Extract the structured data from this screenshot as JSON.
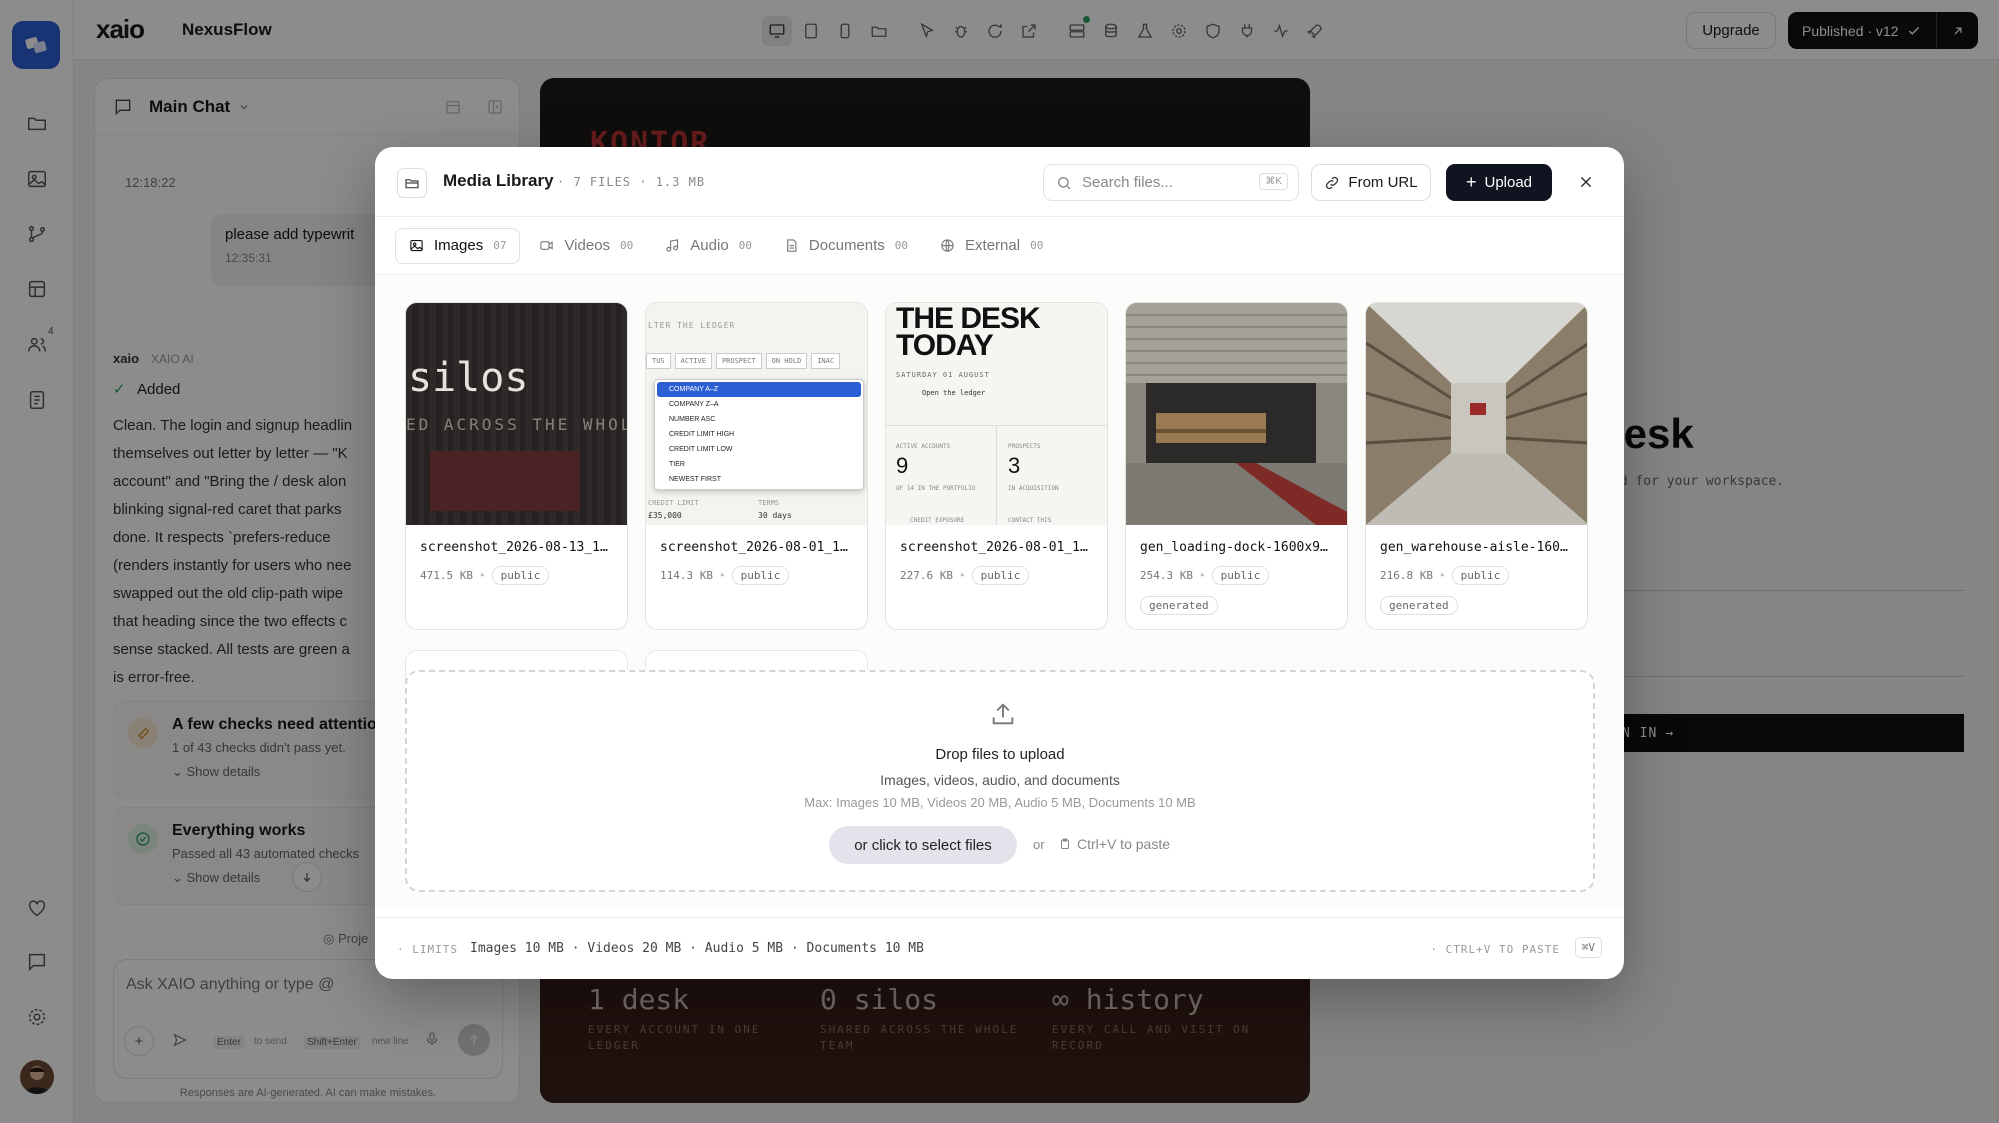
{
  "app": {
    "brand": "xaio",
    "project": "NexusFlow",
    "upgrade_label": "Upgrade",
    "published_label": "Published · v12",
    "rail_badge": "4"
  },
  "chat": {
    "title": "Main Chat",
    "time1": "12:18:22",
    "user_msg": "please add typewrit",
    "user_time": "12:35:31",
    "ai_brand": "xaio",
    "ai_name": "XAIO AI",
    "added": "Added",
    "body_lines": [
      "Clean. The login and signup headlin",
      "themselves out letter by letter — \"K",
      "account\" and \"Bring the / desk alon",
      "blinking signal-red caret that parks",
      "done. It respects `prefers-reduce",
      "(renders instantly for users who nee",
      "swapped out the old clip-path wipe",
      "that heading since the two effects c",
      "sense stacked. All tests are green a",
      "is error-free."
    ],
    "check_title": "A few checks need attentio",
    "check_sub": "1 of 43 checks didn't pass yet.",
    "show_details": "Show details",
    "works_title": "Everything works",
    "works_sub": "Passed all 43 automated checks",
    "proj_label": "Proje",
    "input_placeholder": "Ask XAIO anything or type @",
    "hint_enter": "Enter",
    "hint_send": "to send",
    "hint_shift": "Shift+Enter",
    "hint_newline": "new line",
    "disclaimer": "Responses are AI-generated. AI can make mistakes."
  },
  "preview": {
    "logo_text": "KONTOR",
    "stats": [
      {
        "big": "1 desk",
        "small": "EVERY ACCOUNT IN ONE LEDGER"
      },
      {
        "big": "0 silos",
        "small": "SHARED ACROSS THE WHOLE TEAM"
      },
      {
        "big": "∞ history",
        "small": "EVERY CALL AND VISIT ON RECORD"
      }
    ],
    "right_heading": "lesk",
    "right_sub": "ed for your workspace.",
    "signin": "N IN"
  },
  "modal": {
    "title": "Media Library",
    "meta": "· 7 FILES · 1.3 MB",
    "search_placeholder": "Search files...",
    "search_kbd": "⌘K",
    "from_url": "From URL",
    "upload": "Upload",
    "tabs": [
      {
        "label": "Images",
        "count": "07",
        "icon": "image-icon"
      },
      {
        "label": "Videos",
        "count": "00",
        "icon": "video-icon"
      },
      {
        "label": "Audio",
        "count": "00",
        "icon": "music-icon"
      },
      {
        "label": "Documents",
        "count": "00",
        "icon": "document-icon"
      },
      {
        "label": "External",
        "count": "00",
        "icon": "globe-icon"
      }
    ],
    "files": [
      {
        "name": "screenshot_2026-08-13_1…",
        "size": "471.5 KB",
        "visibility": "public"
      },
      {
        "name": "screenshot_2026-08-01_1…",
        "size": "114.3 KB",
        "visibility": "public"
      },
      {
        "name": "screenshot_2026-08-01_1…",
        "size": "227.6 KB",
        "visibility": "public"
      },
      {
        "name": "gen_loading-dock-1600x9…",
        "size": "254.3 KB",
        "visibility": "public",
        "tag": "generated"
      },
      {
        "name": "gen_warehouse-aisle-160…",
        "size": "216.8 KB",
        "visibility": "public",
        "tag": "generated"
      }
    ],
    "thumb1": {
      "big": "silos",
      "small": "ED ACROSS THE WHOL"
    },
    "thumb2": {
      "header": "LTER THE LEDGER",
      "chips": [
        "TUS",
        "ACTIVE",
        "PROSPECT",
        "ON HOLD",
        "INAC"
      ],
      "menu": [
        "COMPANY A–Z",
        "COMPANY Z–A",
        "NUMBER ASC",
        "CREDIT LIMIT HIGH",
        "CREDIT LIMIT LOW",
        "TIER",
        "NEWEST FIRST"
      ],
      "credit_label": "CREDIT LIMIT",
      "credit_value": "£35,000",
      "terms_label": "TERMS",
      "terms_value": "30 days"
    },
    "thumb3": {
      "title": "THE DESK TODAY",
      "date": "SATURDAY 01 AUGUST",
      "link": "Open the ledger",
      "active_label": "ACTIVE ACCOUNTS",
      "active_value": "9",
      "active_sub": "OF 14 IN THE PORTFOLIO",
      "prospects_label": "PROSPECTS",
      "prospects_value": "3",
      "prospects_sub": "IN ACQUISITION",
      "footer_a": "CREDIT EXPOSURE",
      "footer_b": "CONTACT THIS"
    },
    "drop": {
      "title": "Drop files to upload",
      "types": "Images, videos, audio, and documents",
      "limits": "Max: Images 10 MB, Videos 20 MB, Audio 5 MB, Documents 10 MB",
      "select": "or click to select files",
      "or": "or",
      "paste": "Ctrl+V to paste"
    },
    "footer": {
      "limits_label": "· LIMITS",
      "limits_values": "Images 10 MB · Videos 20 MB · Audio 5 MB · Documents 10 MB",
      "paste_label": "· CTRL+V TO PASTE",
      "paste_kbd": "⌘V"
    }
  },
  "colors": {
    "accent": "#2c5fd4",
    "primary_button": "#0f1420",
    "published": "#111111",
    "signal_red": "#c0392b"
  }
}
